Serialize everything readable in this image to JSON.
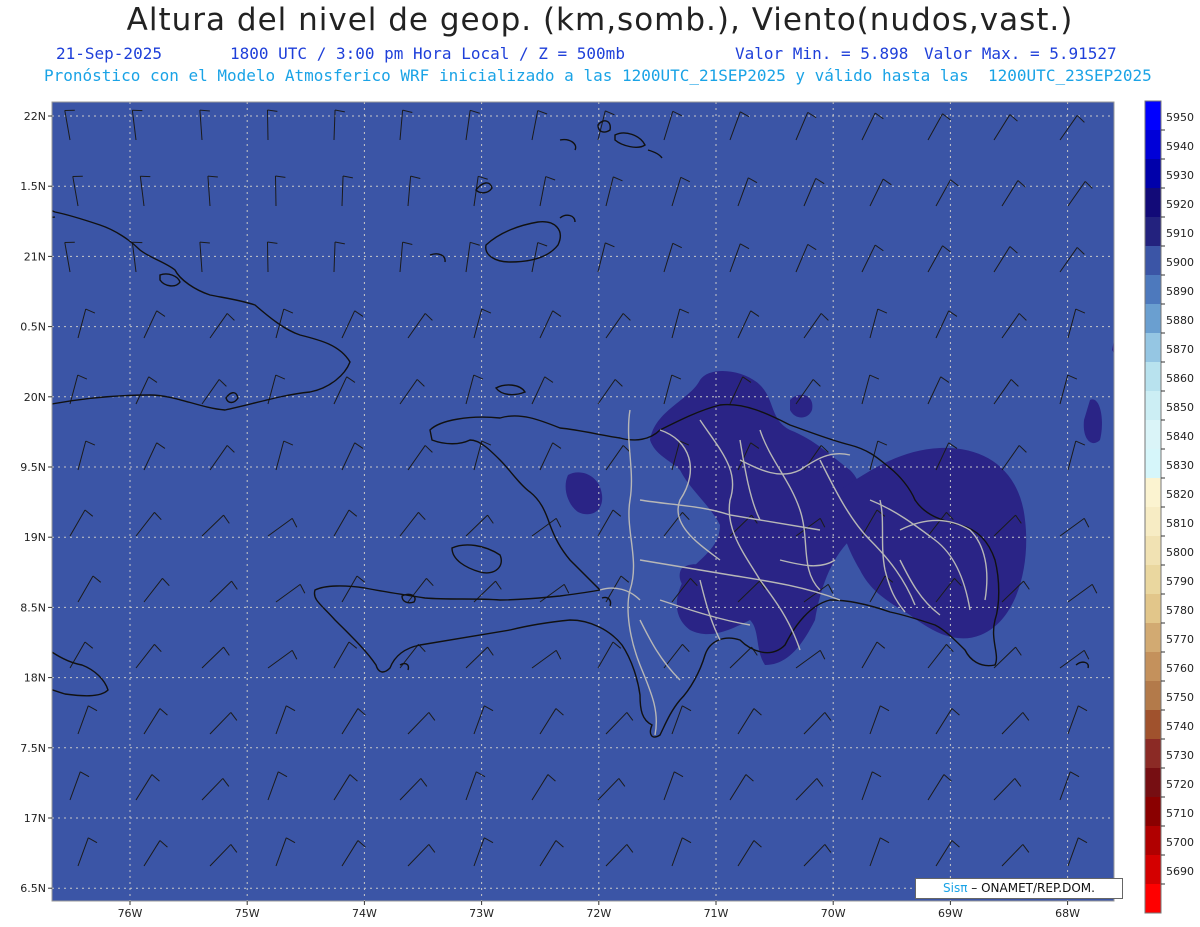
{
  "header": {
    "title": "Altura del nivel de geop. (km,somb.), Viento(nudos,vast.)",
    "date": "21-Sep-2025",
    "time": "1800 UTC / 3:00 pm Hora Local / Z = 500mb",
    "min_label": "Valor Min. = 5.898",
    "max_label": "Valor Max. = 5.91527",
    "model_line": "Pronóstico con el Modelo Atmosferico WRF inicializado a las 1200UTC_21SEP2025 y válido hasta las  1200UTC_23SEP2025"
  },
  "map": {
    "background_color": "#3b55a6",
    "high_color": "#2a2486",
    "coast_color": "#111111",
    "border_color": "#b7b7b7",
    "lat_labels": [
      "22N",
      "1.5N",
      "21N",
      "0.5N",
      "20N",
      "9.5N",
      "19N",
      "8.5N",
      "18N",
      "7.5N",
      "17N",
      "6.5N"
    ],
    "lon_labels": [
      "76W",
      "75W",
      "74W",
      "73W",
      "72W",
      "71W",
      "70W",
      "69W",
      "68W"
    ]
  },
  "colorbar": {
    "levels": [
      "5950",
      "5940",
      "5930",
      "5920",
      "5910",
      "5900",
      "5890",
      "5880",
      "5870",
      "5860",
      "5850",
      "5840",
      "5830",
      "5820",
      "5810",
      "5800",
      "5790",
      "5780",
      "5770",
      "5760",
      "5750",
      "5740",
      "5730",
      "5720",
      "5710",
      "5700",
      "5690"
    ],
    "colors": [
      "#0000ff",
      "#0000d8",
      "#0000aa",
      "#120a78",
      "#23227e",
      "#3b55a6",
      "#4d79bd",
      "#6a9fd0",
      "#95c6e3",
      "#b8e2ee",
      "#cceef4",
      "#daf4f8",
      "#d6f6fa",
      "#fbf3d0",
      "#f7ecc4",
      "#f1e2b3",
      "#ead79f",
      "#e2c68a",
      "#d2aa72",
      "#c4915c",
      "#b37a4a",
      "#a0522d",
      "#8b2a25",
      "#760e12",
      "#8a0000",
      "#b00000",
      "#d40000",
      "#ff0000"
    ]
  },
  "credit": {
    "brand": "Sisπ",
    "org": " – ONAMET/REP.DOM."
  }
}
